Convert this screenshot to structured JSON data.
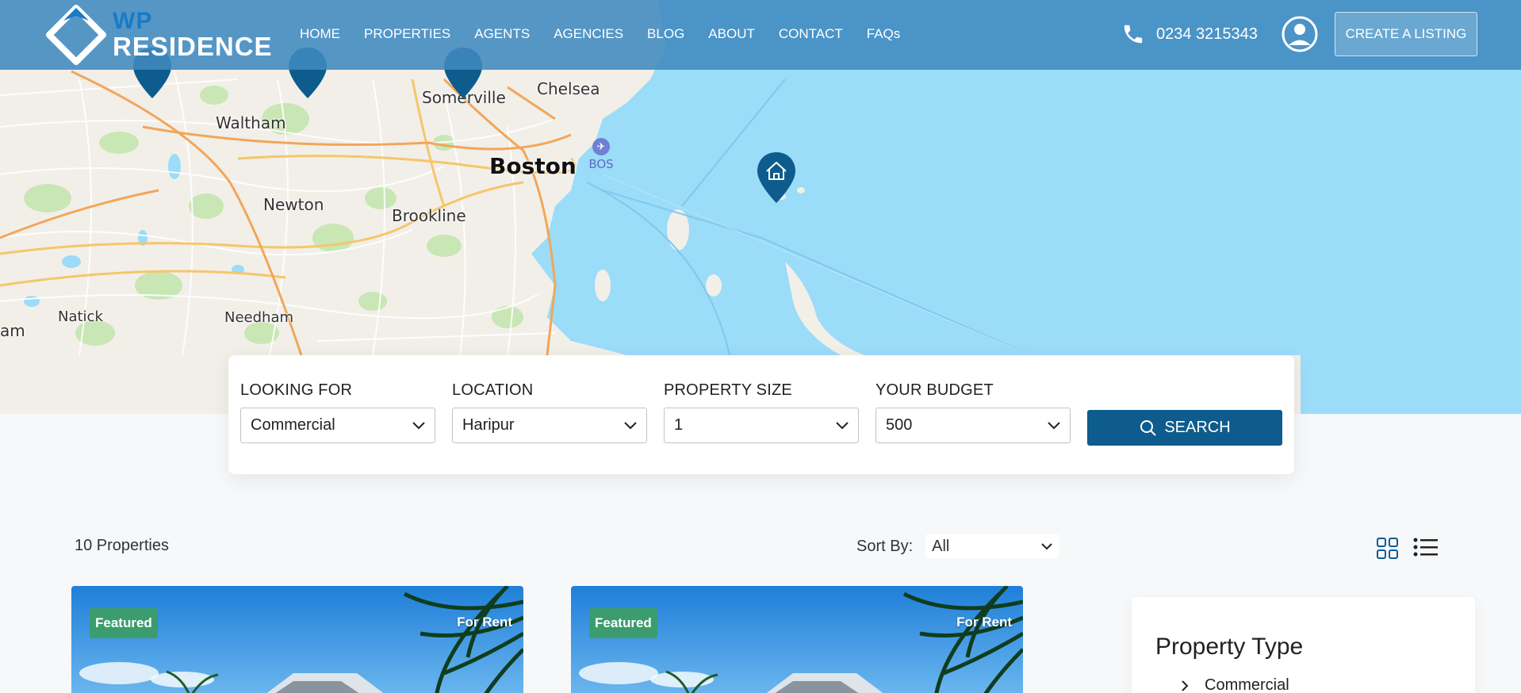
{
  "header": {
    "logo_line1": "WP",
    "logo_line2": "RESIDENCE",
    "nav": [
      "HOME",
      "PROPERTIES",
      "AGENTS",
      "AGENCIES",
      "BLOG",
      "ABOUT",
      "CONTACT",
      "FAQs"
    ],
    "phone": "0234 3215343",
    "create_listing": "CREATE A LISTING"
  },
  "map": {
    "labels": [
      "Waltham",
      "Somerville",
      "Chelsea",
      "Boston",
      "Newton",
      "Brookline",
      "Natick",
      "Needham",
      "am"
    ],
    "airport_code": "BOS",
    "colors": {
      "water": "#9bdcf8",
      "land": "#f2efe9",
      "pin": "#0e5c8e"
    }
  },
  "search": {
    "fields": [
      {
        "label": "LOOKING FOR",
        "value": "Commercial"
      },
      {
        "label": "LOCATION",
        "value": "Haripur"
      },
      {
        "label": "PROPERTY SIZE",
        "value": "1"
      },
      {
        "label": "YOUR BUDGET",
        "value": "500"
      }
    ],
    "button": "SEARCH"
  },
  "results": {
    "count": "10 Properties",
    "sort_label": "Sort By:",
    "sort_value": "All"
  },
  "cards": [
    {
      "featured": "Featured",
      "status": "For Rent"
    },
    {
      "featured": "Featured",
      "status": "For Rent"
    }
  ],
  "sidebar": {
    "title": "Property Type",
    "items": [
      "Commercial"
    ]
  }
}
